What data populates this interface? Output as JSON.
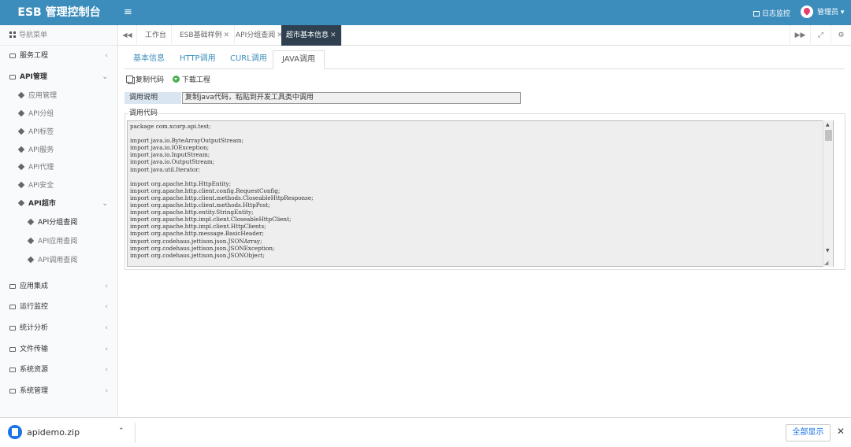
{
  "header": {
    "title": "ESB 管理控制台",
    "menu_toggle": "≡",
    "log_monitor": "日志监控",
    "user_name": "管理员",
    "user_caret": "▾"
  },
  "sidebar": {
    "title": "导航菜单",
    "items": [
      {
        "label": "服务工程",
        "chev": "‹"
      },
      {
        "label": "API管理",
        "chev": "⌄"
      }
    ],
    "api_sub": [
      {
        "label": "应用管理"
      },
      {
        "label": "API分组"
      },
      {
        "label": "API标签"
      },
      {
        "label": "API服务"
      },
      {
        "label": "API代理"
      },
      {
        "label": "API安全"
      },
      {
        "label": "API超市",
        "chev": "⌄"
      }
    ],
    "market_sub": [
      {
        "label": "API分组查阅"
      },
      {
        "label": "API应用查阅"
      },
      {
        "label": "API调用查阅"
      }
    ],
    "rest": [
      {
        "label": "应用集成",
        "chev": "‹"
      },
      {
        "label": "运行监控",
        "chev": "‹"
      },
      {
        "label": "统计分析",
        "chev": "‹"
      },
      {
        "label": "文件传输",
        "chev": "‹"
      },
      {
        "label": "系统资源",
        "chev": "‹"
      },
      {
        "label": "系统管理",
        "chev": "‹"
      }
    ]
  },
  "tabs": {
    "back": "◀◀",
    "forward": "▶▶",
    "expand": "⤢",
    "settings": "⚙",
    "close": "✕",
    "items": [
      {
        "label": "工作台"
      },
      {
        "label": "ESB基础样例"
      },
      {
        "label": "API分组查阅"
      },
      {
        "label": "超市基本信息"
      }
    ]
  },
  "subtabs": [
    "基本信息",
    "HTTP调用",
    "CURL调用",
    "JAVA调用"
  ],
  "actions": {
    "copy": "复制代码",
    "download": "下载工程"
  },
  "desc": {
    "label": "调用说明",
    "value": "复制java代码，粘贴到开发工具类中调用"
  },
  "code": {
    "legend": "调用代码",
    "text": "package com.xcorp.api.test;\n\nimport java.io.ByteArrayOutputStream;\nimport java.io.IOException;\nimport java.io.InputStream;\nimport java.io.OutputStream;\nimport java.util.Iterator;\n\nimport org.apache.http.HttpEntity;\nimport org.apache.http.client.config.RequestConfig;\nimport org.apache.http.client.methods.CloseableHttpResponse;\nimport org.apache.http.client.methods.HttpPost;\nimport org.apache.http.entity.StringEntity;\nimport org.apache.http.impl.client.CloseableHttpClient;\nimport org.apache.http.impl.client.HttpClients;\nimport org.apache.http.message.BasicHeader;\nimport org.codehaus.jettison.json.JSONArray;\nimport org.codehaus.jettison.json.JSONException;\nimport org.codehaus.jettison.json.JSONObject;",
    "scroll_up": "▲",
    "scroll_down": "▼",
    "resize": "◢"
  },
  "download_bar": {
    "filename": "apidemo.zip",
    "caret": "⌃",
    "show_all": "全部显示",
    "close": "✕"
  },
  "colors": {
    "header": "#3c8dbc",
    "active_tab": "#2f4050",
    "link": "#3c8dbc"
  }
}
